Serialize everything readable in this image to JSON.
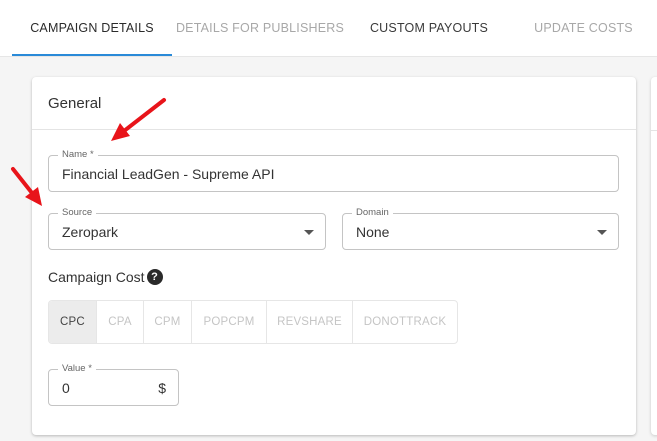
{
  "tabs": [
    {
      "label": "CAMPAIGN DETAILS",
      "active": true
    },
    {
      "label": "DETAILS FOR PUBLISHERS",
      "active": false
    },
    {
      "label": "CUSTOM PAYOUTS",
      "active": false
    },
    {
      "label": "UPDATE COSTS",
      "active": false
    }
  ],
  "general": {
    "title": "General",
    "name": {
      "label": "Name *",
      "value": "Financial LeadGen - Supreme API"
    },
    "source": {
      "label": "Source",
      "value": "Zeropark"
    },
    "domain": {
      "label": "Domain",
      "value": "None"
    },
    "campaign_cost": {
      "label": "Campaign Cost",
      "help_icon": "question-circle-icon",
      "options": [
        "CPC",
        "CPA",
        "CPM",
        "POPCPM",
        "REVSHARE",
        "DONOTTRACK"
      ],
      "selected": "CPC"
    },
    "value": {
      "label": "Value *",
      "value": "0",
      "currency": "$"
    }
  },
  "annotations": {
    "arrow_color": "#e8141a",
    "count": 2
  },
  "colors": {
    "accent": "#2a8ad8",
    "selected_toggle_bg": "#ececec"
  }
}
